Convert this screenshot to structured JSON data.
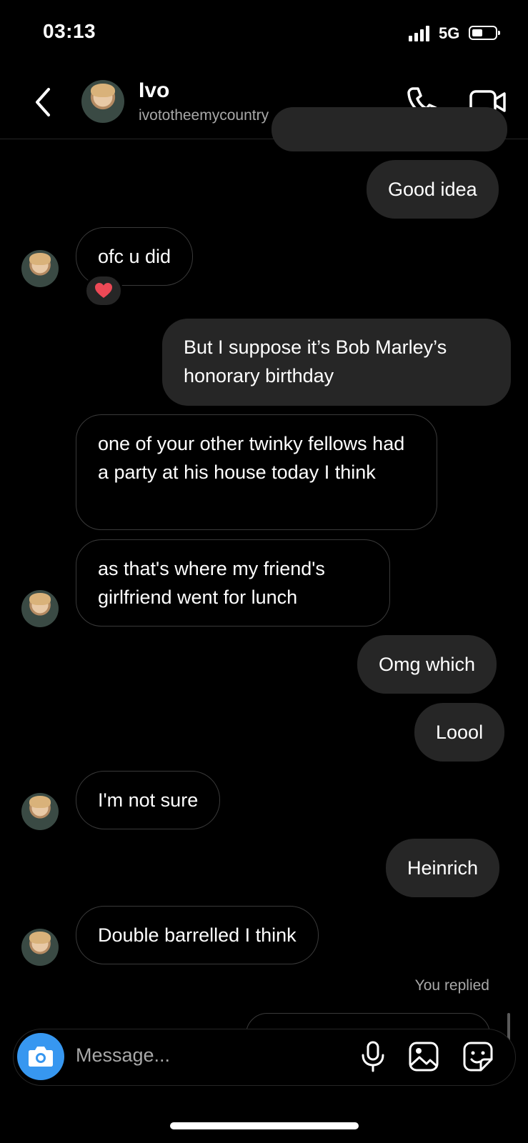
{
  "status_bar": {
    "time": "03:13",
    "network": "5G"
  },
  "header": {
    "name": "Ivo",
    "username": "ivototheemycountry"
  },
  "messages": [
    {
      "from": "me",
      "text": "Good idea"
    },
    {
      "from": "them",
      "text": "ofc u did",
      "reaction": "heart"
    },
    {
      "from": "me",
      "text": "But I suppose it’s Bob Marley’s honorary birthday"
    },
    {
      "from": "them",
      "text": "one of your other twinky fellows had a party at his house today I think"
    },
    {
      "from": "them",
      "text": "as that's where my friend's girlfriend went for lunch"
    },
    {
      "from": "me",
      "text": "Omg which"
    },
    {
      "from": "me",
      "text": "Loool"
    },
    {
      "from": "them",
      "text": "I'm not sure"
    },
    {
      "from": "me",
      "text": "Heinrich"
    },
    {
      "from": "them",
      "text": "Double barrelled I think"
    }
  ],
  "you_replied": "You replied",
  "composer": {
    "placeholder": "Message..."
  },
  "colors": {
    "accent": "#3797f0",
    "outgoing_bubble": "#262626",
    "reaction": "#ed4956"
  }
}
